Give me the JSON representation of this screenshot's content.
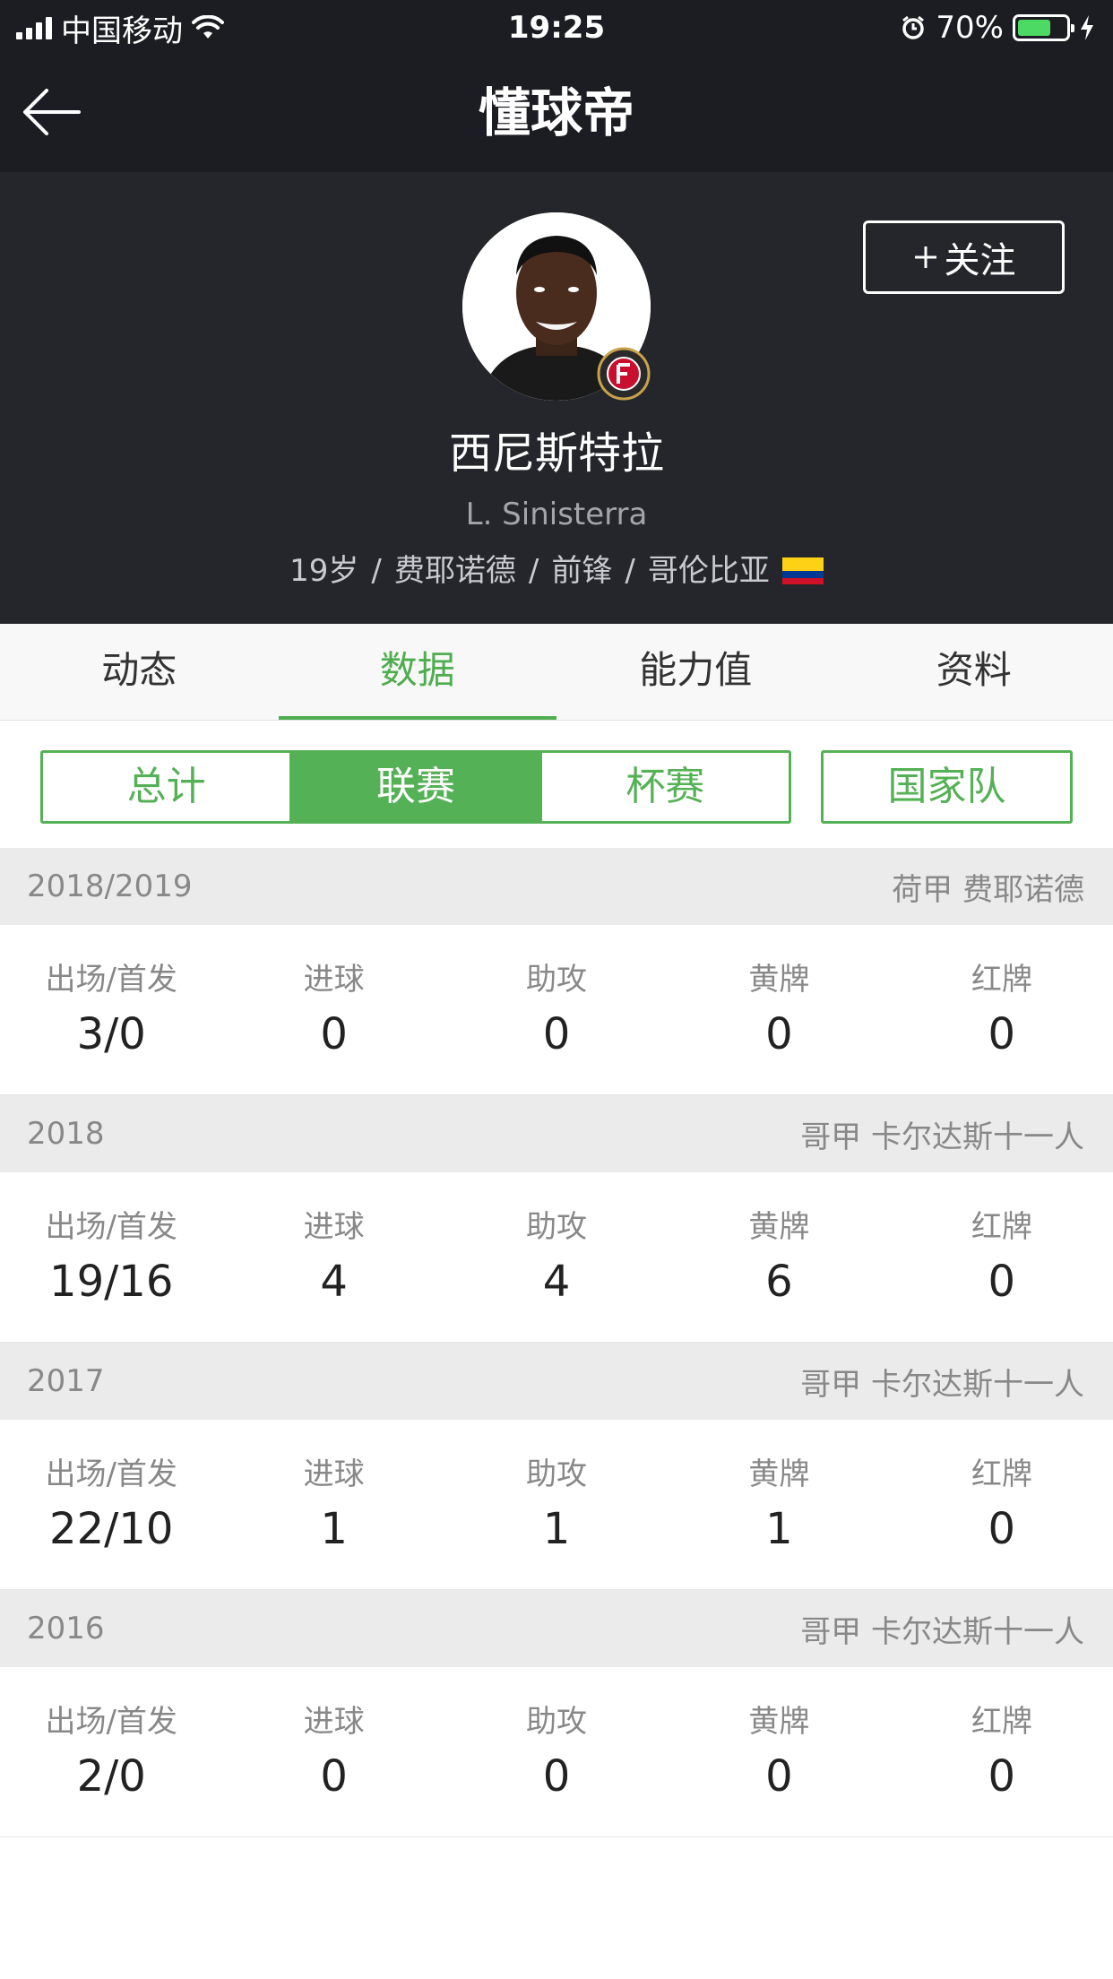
{
  "status_bar": {
    "carrier": "中国移动",
    "time": "19:25",
    "battery_percent": "70%",
    "battery_level": 0.7
  },
  "nav": {
    "title": "懂球帝",
    "back_icon": "back-arrow-icon"
  },
  "player": {
    "name": "西尼斯特拉",
    "name_en": "L. Sinisterra",
    "age": "19岁",
    "club": "费耶诺德",
    "position": "前锋",
    "nationality": "哥伦比亚",
    "follow_label": "关注"
  },
  "tabs": [
    {
      "label": "动态"
    },
    {
      "label": "数据"
    },
    {
      "label": "能力值"
    },
    {
      "label": "资料"
    }
  ],
  "segments": [
    {
      "label": "总计"
    },
    {
      "label": "联赛"
    },
    {
      "label": "杯赛"
    }
  ],
  "national_team_label": "国家队",
  "stat_labels": [
    "出场/首发",
    "进球",
    "助攻",
    "黄牌",
    "红牌"
  ],
  "seasons": [
    {
      "season": "2018/2019",
      "league": "荷甲 费耶诺德",
      "values": [
        "3/0",
        "0",
        "0",
        "0",
        "0"
      ]
    },
    {
      "season": "2018",
      "league": "哥甲 卡尔达斯十一人",
      "values": [
        "19/16",
        "4",
        "4",
        "6",
        "0"
      ]
    },
    {
      "season": "2017",
      "league": "哥甲 卡尔达斯十一人",
      "values": [
        "22/10",
        "1",
        "1",
        "1",
        "0"
      ]
    },
    {
      "season": "2016",
      "league": "哥甲 卡尔达斯十一人",
      "values": [
        "2/0",
        "0",
        "0",
        "0",
        "0"
      ]
    }
  ],
  "colors": {
    "accent": "#55b155",
    "header_bg": "#25262b",
    "nav_bg": "#1c1d22",
    "battery": "#4cd964"
  }
}
